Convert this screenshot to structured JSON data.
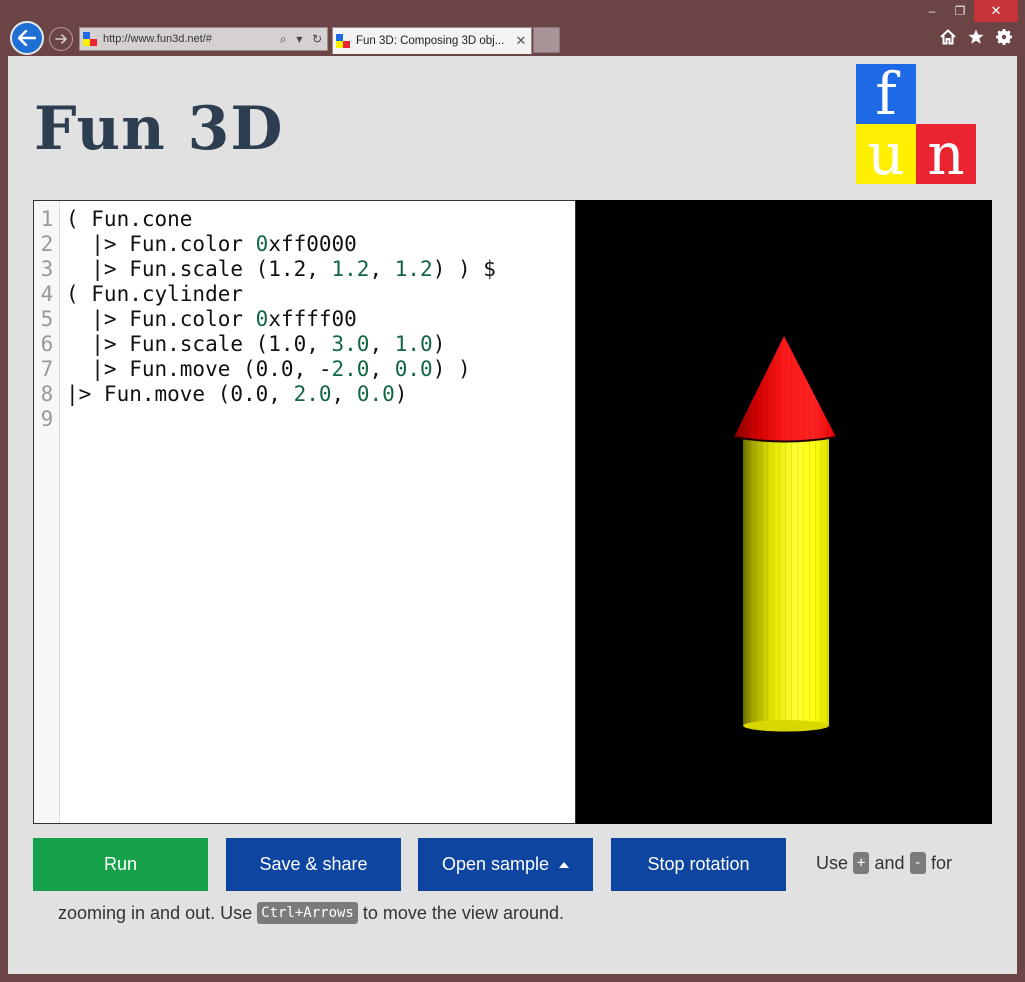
{
  "browser": {
    "address": "http://www.fun3d.net/#",
    "tab_title": "Fun 3D: Composing 3D obj...",
    "win_min": "–",
    "win_max": "❐",
    "win_close": "✕",
    "tab_close": "✕",
    "icons": [
      "back-arrow-icon",
      "forward-arrow-icon",
      "search-icon",
      "refresh-icon",
      "home-icon",
      "favorites-star-icon",
      "settings-gear-icon"
    ]
  },
  "page": {
    "title": "Fun 3D",
    "logo": {
      "f": "f",
      "u": "u",
      "n": "n",
      "colors": {
        "f": "#1e6ae6",
        "u": "#ffef00",
        "n": "#ea2431"
      }
    }
  },
  "editor": {
    "lines": [
      {
        "n": "1",
        "parts": [
          [
            "t",
            "( Fun.cone"
          ]
        ]
      },
      {
        "n": "2",
        "parts": [
          [
            "t",
            "  |> Fun.color "
          ],
          [
            "n",
            "0"
          ],
          [
            "t",
            "xff0000"
          ]
        ]
      },
      {
        "n": "3",
        "parts": [
          [
            "t",
            "  |> Fun.scale (1.2, "
          ],
          [
            "n",
            "1.2"
          ],
          [
            "t",
            ", "
          ],
          [
            "n",
            "1.2"
          ],
          [
            "t",
            ") ) $"
          ]
        ]
      },
      {
        "n": "4",
        "parts": [
          [
            "t",
            "( Fun.cylinder"
          ]
        ]
      },
      {
        "n": "5",
        "parts": [
          [
            "t",
            "  |> Fun.color "
          ],
          [
            "n",
            "0"
          ],
          [
            "t",
            "xffff00"
          ]
        ]
      },
      {
        "n": "6",
        "parts": [
          [
            "t",
            "  |> Fun.scale (1.0, "
          ],
          [
            "n",
            "3.0"
          ],
          [
            "t",
            ", "
          ],
          [
            "n",
            "1.0"
          ],
          [
            "t",
            ")"
          ]
        ]
      },
      {
        "n": "7",
        "parts": [
          [
            "t",
            "  |> Fun.move (0.0, -"
          ],
          [
            "n",
            "2.0"
          ],
          [
            "t",
            ", "
          ],
          [
            "n",
            "0.0"
          ],
          [
            "t",
            ") )"
          ]
        ]
      },
      {
        "n": "8",
        "parts": [
          [
            "t",
            "|> Fun.move (0.0, "
          ],
          [
            "n",
            "2.0"
          ],
          [
            "t",
            ", "
          ],
          [
            "n",
            "0.0"
          ],
          [
            "t",
            ")"
          ]
        ]
      },
      {
        "n": "9",
        "parts": []
      }
    ]
  },
  "scene": {
    "cone_color": "#ff0000",
    "cylinder_color": "#ffff00",
    "background": "#000000"
  },
  "buttons": {
    "run": "Run",
    "save": "Save & share",
    "sample": "Open sample",
    "stop": "Stop rotation"
  },
  "help": {
    "use": "Use",
    "plus": "+",
    "and": "and",
    "minus": "-",
    "for": "for",
    "zoom": "zooming in and out. Use",
    "ctrl": "Ctrl+Arrows",
    "move": "to move the view around."
  }
}
